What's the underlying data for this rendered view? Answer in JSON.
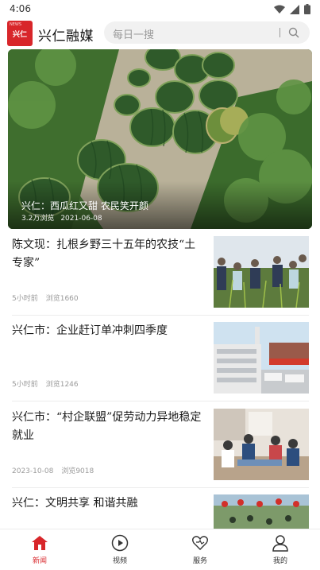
{
  "status_bar": {
    "time": "4:06"
  },
  "header": {
    "logo_text": "兴仁",
    "logo_small": "NEWS",
    "app_title": "兴仁融媒",
    "search_placeholder": "每日一搜"
  },
  "hero": {
    "title": "兴仁：西瓜红又甜 农民笑开颜",
    "views": "3.2万浏览",
    "date": "2021-06-08"
  },
  "news": [
    {
      "title": "陈文现：扎根乡野三十五年的农技“土专家”",
      "time": "5小时前",
      "views": "浏览1660"
    },
    {
      "title": "兴仁市：企业赶订单冲刺四季度",
      "time": "5小时前",
      "views": "浏览1246"
    },
    {
      "title": "兴仁市：“村企联盟”促劳动力异地稳定就业",
      "time": "2023-10-08",
      "views": "浏览9018"
    },
    {
      "title": "兴仁：文明共享 和谐共融",
      "time": "",
      "views": ""
    }
  ],
  "bottom_nav": [
    {
      "label": "新闻",
      "icon": "home-icon",
      "active": true
    },
    {
      "label": "视频",
      "icon": "play-icon",
      "active": false
    },
    {
      "label": "服务",
      "icon": "heart-icon",
      "active": false
    },
    {
      "label": "我的",
      "icon": "user-icon",
      "active": false
    }
  ],
  "colors": {
    "accent": "#d8262a",
    "meta": "#9a9a9a"
  }
}
